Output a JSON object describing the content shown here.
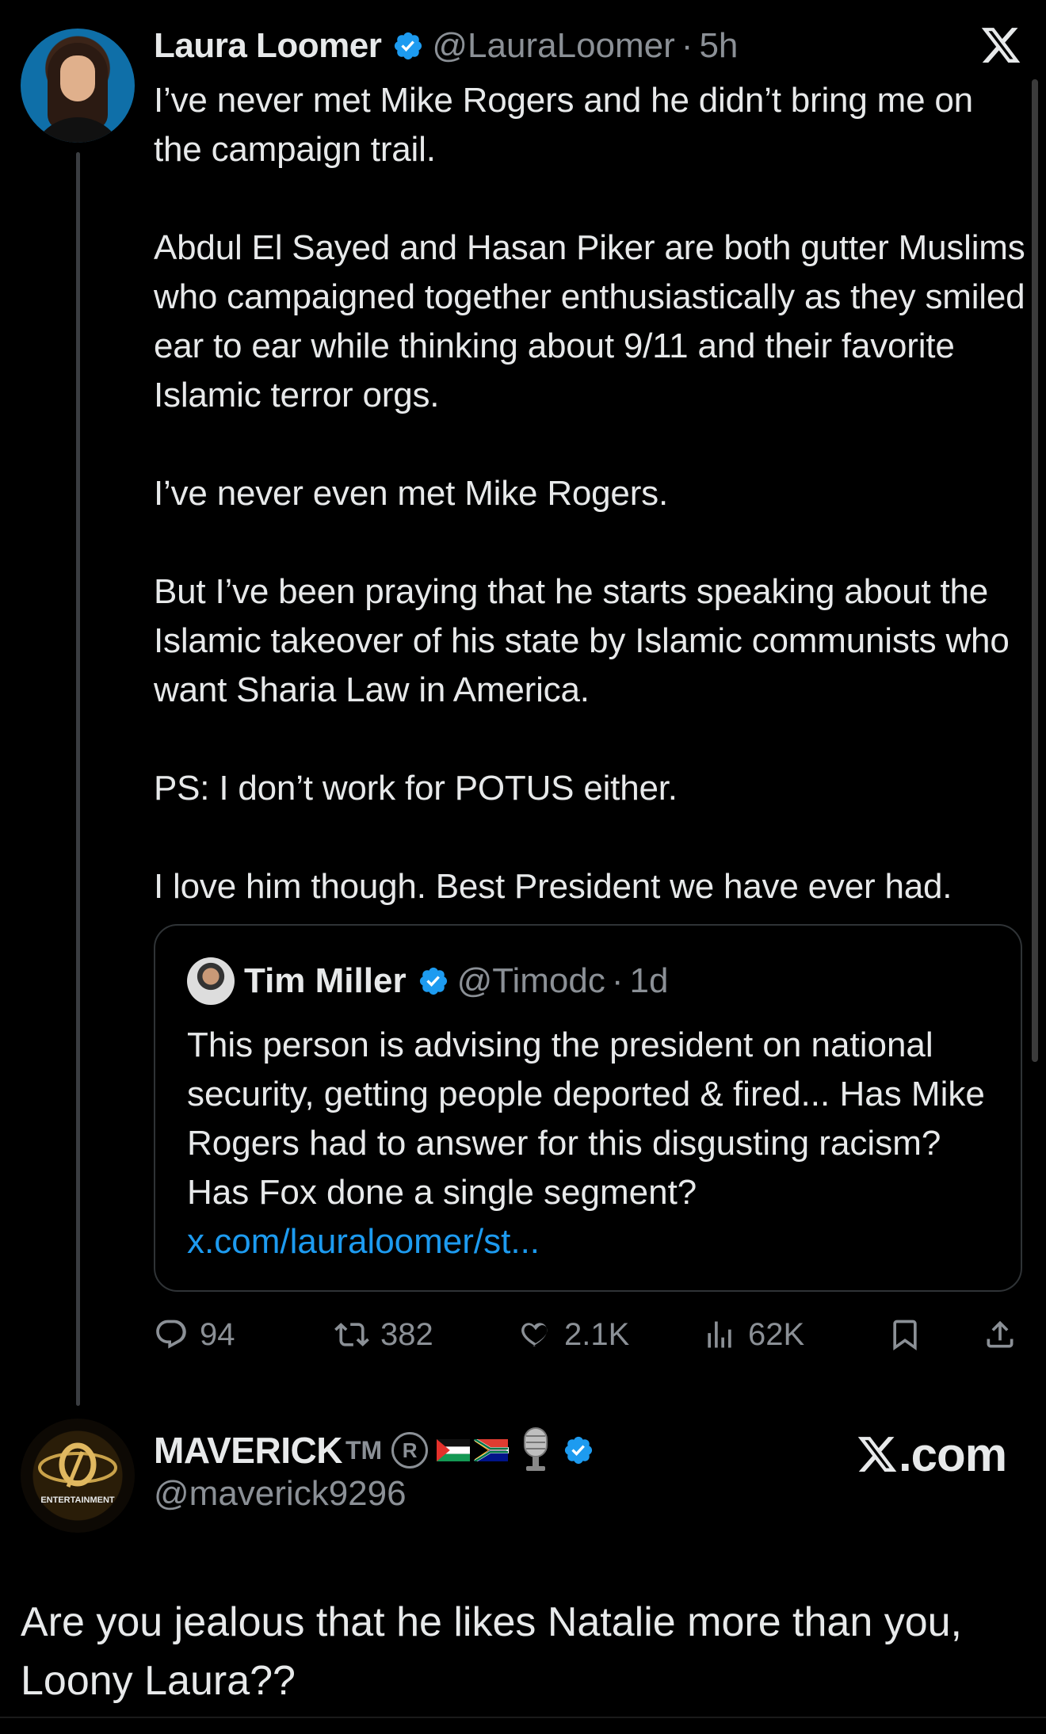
{
  "main_tweet": {
    "author_name": "Laura Loomer",
    "handle": "@LauraLoomer",
    "separator": "·",
    "time": "5h",
    "paragraphs": [
      "I’ve never met Mike Rogers and he didn’t bring me on the campaign trail.",
      "Abdul El Sayed and Hasan Piker are both gutter Muslims who campaigned together enthusiastically as they smiled ear to ear while thinking about 9/11 and their favorite Islamic terror orgs.",
      "I’ve never even met Mike Rogers.",
      "But I’ve been praying that he starts speaking about the Islamic takeover of his state by Islamic communists who want Sharia Law in America.",
      "PS: I don’t work for POTUS either.",
      "I love him though. Best President we have ever had."
    ],
    "quote": {
      "author_name": "Tim Miller",
      "handle": "@Timodc",
      "separator": "·",
      "time": "1d",
      "text": "This person is advising the president on national security, getting people deported & fired... Has Mike Rogers had to answer for this disgusting racism? Has Fox done a single segment?",
      "link": "x.com/lauraloomer/st..."
    },
    "actions": {
      "replies": "94",
      "reposts": "382",
      "likes": "2.1K",
      "views": "62K"
    }
  },
  "reply_tweet": {
    "author_name": "MAVERICK",
    "tm": "TM",
    "reg": "R",
    "handle": "@maverick9296",
    "avatar_text": "ENTERTAINMENT",
    "text": "Are you jealous that he likes Natalie more than you, Loony Laura??"
  },
  "brand": {
    "suffix": ".com"
  },
  "colors": {
    "background": "#000000",
    "text": "#e7e9ea",
    "muted": "#8b9096",
    "link": "#1d9bf0",
    "verified": "#1d9bf0",
    "border": "#2f3336"
  },
  "icons": {
    "close": "x-logo-icon",
    "verified": "verified-badge-icon",
    "reply": "reply-icon",
    "repost": "repost-icon",
    "like": "heart-icon",
    "views": "views-icon",
    "bookmark": "bookmark-icon",
    "share": "share-icon"
  }
}
